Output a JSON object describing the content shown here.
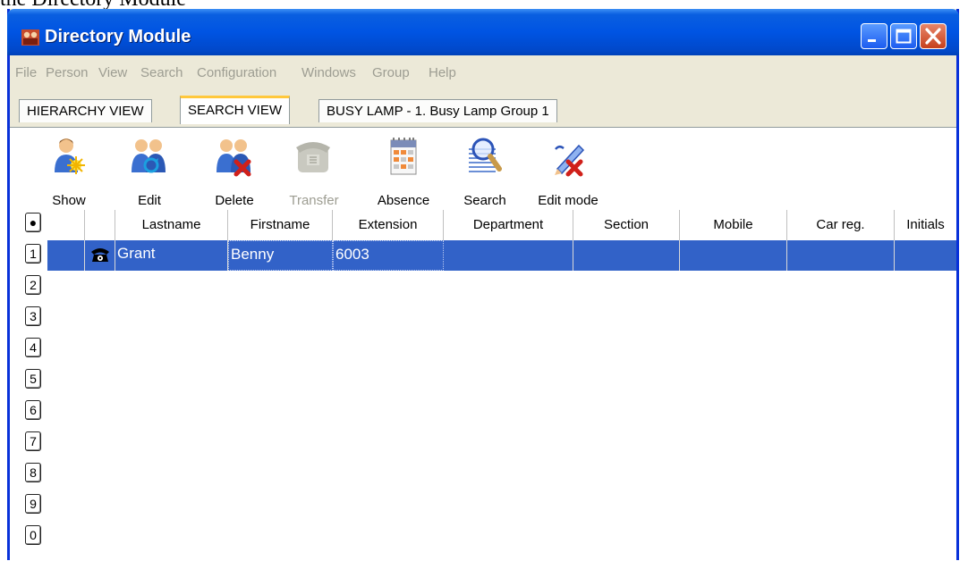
{
  "caption": "the Directory Module",
  "window": {
    "title": "Directory Module",
    "app_icon": "people-group-icon",
    "controls": [
      "minimize-icon",
      "maximize-icon",
      "close-icon"
    ]
  },
  "menu": [
    "File",
    "Person",
    "View",
    "Search",
    "Configuration",
    "Windows",
    "Group",
    "Help"
  ],
  "tabs": [
    {
      "label": "HIERARCHY VIEW",
      "active": false
    },
    {
      "label": "SEARCH VIEW",
      "active": true
    },
    {
      "label": "BUSY LAMP - 1. Busy Lamp Group 1",
      "active": false
    }
  ],
  "toolbar": [
    {
      "label": "Show",
      "icon": "person-sun-icon",
      "enabled": true
    },
    {
      "label": "Edit",
      "icon": "people-edit-icon",
      "enabled": true
    },
    {
      "label": "Delete",
      "icon": "people-delete-icon",
      "enabled": true
    },
    {
      "label": "Transfer",
      "icon": "phone-icon",
      "enabled": false
    },
    {
      "label": "Absence",
      "icon": "calendar-icon",
      "enabled": true
    },
    {
      "label": "Search",
      "icon": "magnifier-icon",
      "enabled": true
    },
    {
      "label": "Edit mode",
      "icon": "pencil-cross-icon",
      "enabled": true
    }
  ],
  "row_nav": [
    "●",
    "1",
    "2",
    "3",
    "4",
    "5",
    "6",
    "7",
    "8",
    "9",
    "0"
  ],
  "grid": {
    "columns": [
      "",
      "",
      "Lastname",
      "Firstname",
      "Extension",
      "Department",
      "Section",
      "Mobile",
      "Car reg.",
      "Initials"
    ],
    "rows": [
      {
        "icon": "telephone-icon",
        "selected": true,
        "cells": [
          "Grant",
          "Benny",
          "6003",
          "",
          "",
          "",
          "",
          ""
        ]
      }
    ]
  },
  "colors": {
    "titlebar": "#0054e3",
    "selection": "#3262c8",
    "active_tab_accent": "#ffc83c",
    "disabled_text": "#9d9d92"
  }
}
